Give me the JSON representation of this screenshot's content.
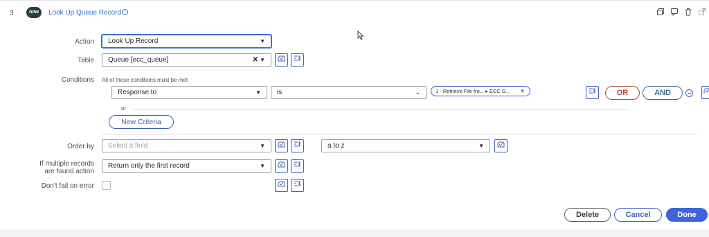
{
  "step": {
    "number": "3",
    "logo_text": "now",
    "title": "Look Up Queue Record",
    "info_icon": "ⓘ",
    "header_icons": [
      "copy-icon",
      "comment-icon",
      "trash-icon",
      "external-link-icon"
    ]
  },
  "fields": {
    "action": {
      "label": "Action",
      "value": "Look Up Record"
    },
    "table": {
      "label": "Table",
      "value": "Queue [ecc_queue]",
      "clear_glyph": "✕"
    },
    "conditions": {
      "label": "Conditions",
      "hint": "All of these conditions must be met",
      "field": "Response to",
      "operator": "is",
      "value_chip": "1 - Retrieve File fro... ▸ ECC S...",
      "chip_close": "✕",
      "or_label": "or",
      "or_button": "OR",
      "and_button": "AND",
      "new_criteria": "New Criteria"
    },
    "order_by": {
      "label": "Order by",
      "placeholder": "Select a field",
      "direction": "a to z"
    },
    "multiple": {
      "label_line1": "If multiple records",
      "label_line2": "are found action",
      "value": "Return only the first record"
    },
    "dont_fail": {
      "label": "Don't fail on error"
    }
  },
  "footer": {
    "delete": "Delete",
    "cancel": "Cancel",
    "done": "Done"
  },
  "colors": {
    "accent": "#3b5dbd",
    "done_bg": "#3e63dd",
    "or_color": "#b34a3c",
    "link": "#2f6bd6"
  }
}
